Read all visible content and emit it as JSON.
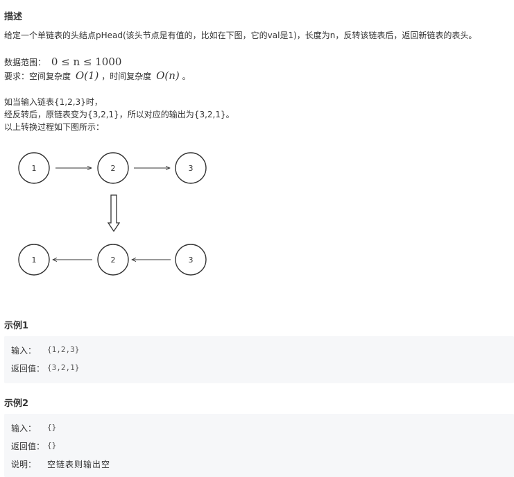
{
  "description": {
    "heading": "描述",
    "intro": "给定一个单链表的头结点pHead(该头节点是有值的，比如在下图，它的val是1)，长度为n，反转该链表后，返回新链表的表头。",
    "range_label": "数据范围：",
    "range_math": "0 ≤ n ≤ 1000",
    "req_label": "要求：空间复杂度",
    "req_space": "O(1)",
    "req_mid": "，时间复杂度",
    "req_time": "O(n)",
    "req_end": "。",
    "line1": "如当输入链表{1,2,3}时，",
    "line2": "经反转后，原链表变为{3,2,1}，所以对应的输出为{3,2,1}。",
    "line3": "以上转换过程如下图所示："
  },
  "diagram": {
    "top_nodes": [
      "1",
      "2",
      "3"
    ],
    "bottom_nodes": [
      "1",
      "2",
      "3"
    ]
  },
  "examples": [
    {
      "heading": "示例1",
      "input_label": "输入：",
      "input_value": "{1,2,3}",
      "return_label": "返回值：",
      "return_value": "{3,2,1}"
    },
    {
      "heading": "示例2",
      "input_label": "输入：",
      "input_value": "{}",
      "return_label": "返回值：",
      "return_value": "{}",
      "note_label": "说明：",
      "note_value": "空链表则输出空"
    }
  ]
}
